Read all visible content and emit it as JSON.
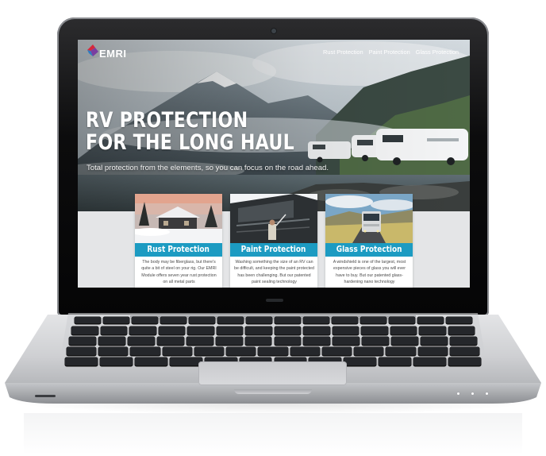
{
  "site": {
    "logo_text": "EMRI",
    "brand_colors": {
      "accent": "#1c9bc2",
      "logo_red": "#d6283c",
      "logo_purple": "#7a3fa0",
      "logo_blue": "#2c7ec2"
    },
    "nav": [
      {
        "label": "Rust Protection"
      },
      {
        "label": "Paint Protection"
      },
      {
        "label": "Glass Protection"
      }
    ]
  },
  "hero": {
    "title": "RV PROTECTION\nFOR THE LONG HAUL",
    "subtitle": "Total protection from the elements, so you can focus on the road ahead."
  },
  "cards": [
    {
      "title": "Rust Protection",
      "photo": "snowy-house-photo",
      "body": "The body may be fiberglass, but there's quite a bit of steel on your rig. Our EMRI Module offers seven year rust protection on all metal parts"
    },
    {
      "title": "Paint Protection",
      "photo": "rv-washing-photo",
      "body": "Washing something the size of an RV can be difficult, and keeping the paint protected has been challenging. But our patented paint sealing technology"
    },
    {
      "title": "Glass Protection",
      "photo": "bus-on-road-photo",
      "body": "A windshield is one of the largest, most expensive pieces of glass you will ever have to buy. But our patented glass-hardening nano technology"
    }
  ],
  "device": {
    "type": "laptop",
    "indicator_lights": 3
  }
}
